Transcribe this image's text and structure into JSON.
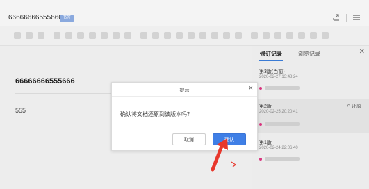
{
  "header": {
    "title": "66666666555666",
    "badge": "书签",
    "icons": [
      "share-icon",
      "menu-icon"
    ]
  },
  "toolbar": {
    "icons": [
      "undo-icon",
      "redo-icon",
      "format-painter-icon",
      "clear-format-icon",
      "heading-icon",
      "bold-icon",
      "italic-icon",
      "underline-icon",
      "strikethrough-icon",
      "font-color-icon",
      "highlight-icon",
      "align-left-icon",
      "align-center-icon",
      "align-right-icon",
      "justify-icon",
      "list-ordered-icon",
      "list-bullet-icon",
      "indent-icon",
      "outdent-icon",
      "link-icon",
      "image-icon",
      "table-icon",
      "code-icon",
      "quote-icon",
      "divider-icon",
      "more-icon"
    ]
  },
  "document": {
    "heading": "66666666555666",
    "body": "555"
  },
  "panel": {
    "tabs": [
      {
        "label": "修订记录",
        "active": true
      },
      {
        "label": "浏览记录",
        "active": false
      }
    ],
    "versions": [
      {
        "name": "第3版(当前)",
        "time": "2020-02-27 13:48:24",
        "selected": false
      },
      {
        "name": "第2版",
        "time": "2020-02-25 20:20:41",
        "selected": true,
        "restore": "还原"
      },
      {
        "name": "第1版",
        "time": "2020-02-24 22:06:40",
        "selected": false
      }
    ],
    "accent": "#3a7bd5",
    "dot_color": "#d9367f"
  },
  "dialog": {
    "title": "提示",
    "message": "确认将文档还原到该版本吗？",
    "cancel_label": "取消",
    "ok_label": "确认",
    "ok_color": "#3f7fe6"
  },
  "annotation": {
    "arrow_color": "#e8372c"
  }
}
